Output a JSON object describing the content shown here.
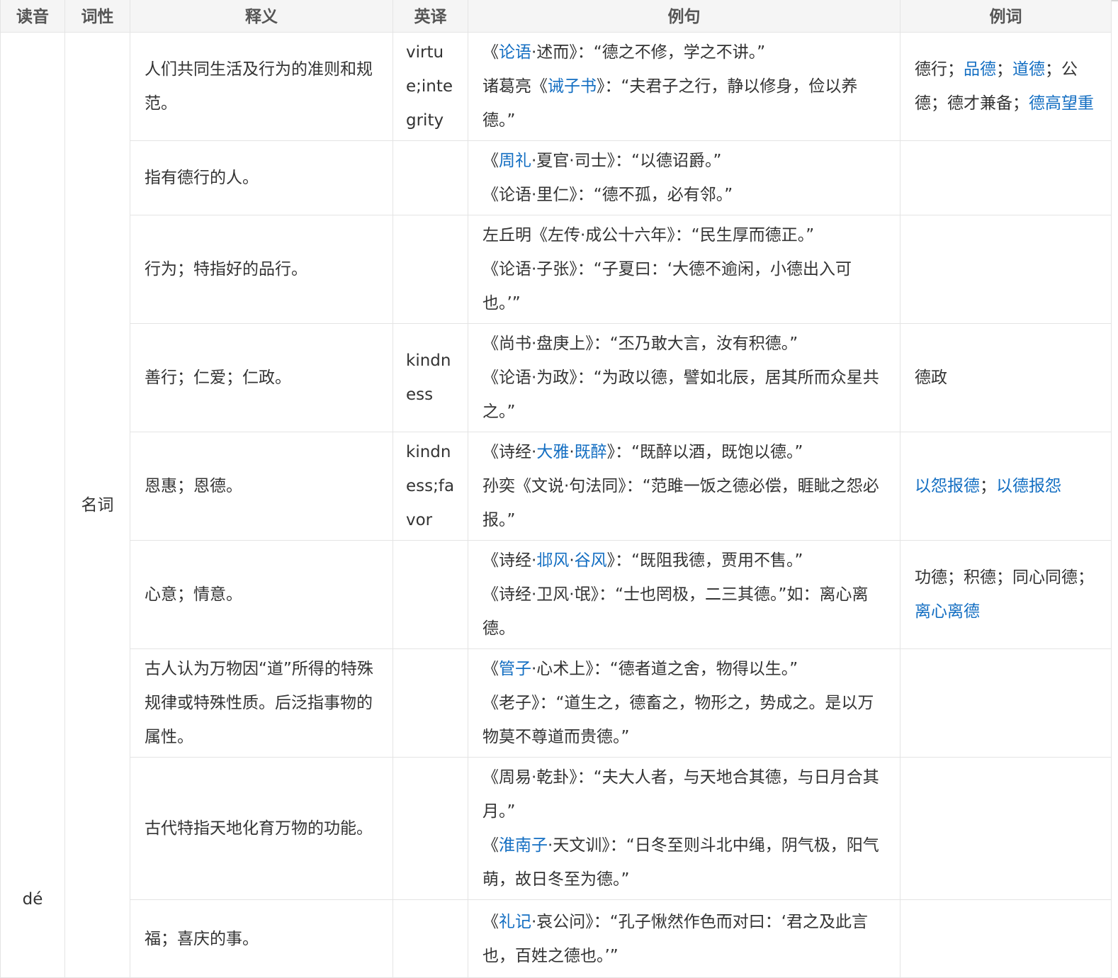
{
  "headers": [
    "读音",
    "词性",
    "释义",
    "英译",
    "例句",
    "例词"
  ],
  "reading": "dé",
  "pos": "名词",
  "rows": [
    {
      "def": "人们共同生活及行为的准则和规范。",
      "en": "virtue;integrity",
      "examples": [
        [
          {
            "t": "《"
          },
          {
            "t": "论语",
            "link": true
          },
          {
            "t": "·述而》：“德之不修，学之不讲。”"
          }
        ],
        [
          {
            "t": "诸葛亮《"
          },
          {
            "t": "诫子书",
            "link": true
          },
          {
            "t": "》：“夫君子之行，静以修身，俭以养德。”"
          }
        ]
      ],
      "words": [
        {
          "t": "德行；"
        },
        {
          "t": "品德",
          "link": true
        },
        {
          "t": "；"
        },
        {
          "t": "道德",
          "link": true
        },
        {
          "t": "；公德；德才兼备；"
        },
        {
          "t": "德高望重",
          "link": true
        }
      ]
    },
    {
      "def": "指有德行的人。",
      "en": "",
      "examples": [
        [
          {
            "t": "《"
          },
          {
            "t": "周礼",
            "link": true
          },
          {
            "t": "·夏官·司士》：“以德诏爵。”"
          }
        ],
        [
          {
            "t": "《论语·里仁》：“德不孤，必有邻。”"
          }
        ]
      ],
      "words": []
    },
    {
      "def": "行为；特指好的品行。",
      "en": "",
      "examples": [
        [
          {
            "t": "左丘明《左传·成公十六年》：“民生厚而德正。”"
          }
        ],
        [
          {
            "t": "《论语·子张》：“子夏曰：‘大德不逾闲，小德出入可也。’”"
          }
        ]
      ],
      "words": []
    },
    {
      "def": "善行；仁爱；仁政。",
      "en": "kindness",
      "examples": [
        [
          {
            "t": "《尚书·盘庚上》：“丕乃敢大言，汝有积德。”"
          }
        ],
        [
          {
            "t": "《论语·为政》：“为政以德，譬如北辰，居其所而众星共之。”"
          }
        ]
      ],
      "words": [
        {
          "t": "德政"
        }
      ]
    },
    {
      "def": "恩惠；恩德。",
      "en": "kindness;favor",
      "examples": [
        [
          {
            "t": "《诗经·"
          },
          {
            "t": "大雅",
            "link": true
          },
          {
            "t": "·"
          },
          {
            "t": "既醉",
            "link": true
          },
          {
            "t": "》：“既醉以酒，既饱以德。”"
          }
        ],
        [
          {
            "t": "孙奕《文说·句法同》：“范雎一饭之德必偿，睚眦之怨必报。”"
          }
        ]
      ],
      "words": [
        {
          "t": "以怨报德",
          "link": true
        },
        {
          "t": "；"
        },
        {
          "t": "以德报怨",
          "link": true
        }
      ]
    },
    {
      "def": "心意；情意。",
      "en": "",
      "examples": [
        [
          {
            "t": "《诗经·"
          },
          {
            "t": "邶风",
            "link": true
          },
          {
            "t": "·"
          },
          {
            "t": "谷风",
            "link": true
          },
          {
            "t": "》：“既阻我德，贾用不售。”"
          }
        ],
        [
          {
            "t": "《诗经·卫风·氓》：“士也罔极，二三其德。”如：离心离德。"
          }
        ]
      ],
      "words": [
        {
          "t": "功德；积德；同心同德；"
        },
        {
          "t": "离心离德",
          "link": true
        }
      ]
    },
    {
      "def": "古人认为万物因“道”所得的特殊规律或特殊性质。后泛指事物的属性。",
      "en": "",
      "examples": [
        [
          {
            "t": "《"
          },
          {
            "t": "管子",
            "link": true
          },
          {
            "t": "·心术上》：“德者道之舍，物得以生。”"
          }
        ],
        [
          {
            "t": "《老子》：“道生之，德畜之，物形之，势成之。是以万物莫不尊道而贵德。”"
          }
        ]
      ],
      "words": []
    },
    {
      "def": "古代特指天地化育万物的功能。",
      "en": "",
      "examples": [
        [
          {
            "t": "《周易·乾卦》：“夫大人者，与天地合其德，与日月合其月。”"
          }
        ],
        [
          {
            "t": "《"
          },
          {
            "t": "淮南子",
            "link": true
          },
          {
            "t": "·天文训》：“日冬至则斗北中绳，阴气极，阳气萌，故日冬至为德。”"
          }
        ]
      ],
      "words": []
    },
    {
      "def": "福；喜庆的事。",
      "en": "",
      "examples": [
        [
          {
            "t": "《"
          },
          {
            "t": "礼记",
            "link": true
          },
          {
            "t": "·哀公问》：“孔子愀然作色而对曰：‘君之及此言也，百姓之德也。’”"
          }
        ]
      ],
      "words": []
    }
  ],
  "colors": {
    "link": "#136ec2",
    "text": "#333333",
    "header_bg": "#f5f5f5",
    "border": "#e4e4e4"
  }
}
